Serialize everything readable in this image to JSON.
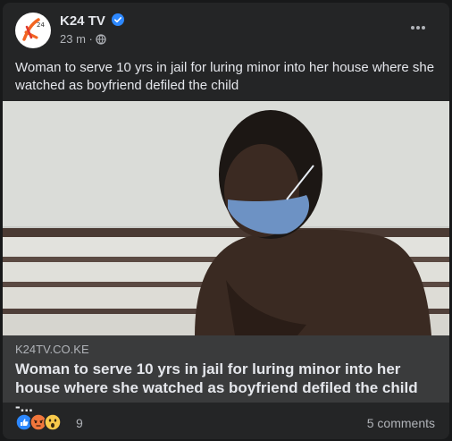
{
  "post": {
    "page_name": "K24 TV",
    "time": "23 m",
    "separator": "·",
    "avatar_icon": "k24-logo-icon",
    "verified_icon": "verified-badge-icon",
    "privacy_icon": "globe-icon",
    "more_icon": "more-options-icon",
    "text": "Woman to serve 10 yrs in jail for luring minor into her house where she watched as boyfriend defiled the child"
  },
  "link_preview": {
    "domain": "K24TV.CO.KE",
    "title": "Woman to serve 10 yrs in jail for luring minor into her house where she watched as boyfriend defiled the child -..."
  },
  "footer": {
    "reactions": [
      "like-reaction-icon",
      "angry-reaction-icon",
      "wow-reaction-icon"
    ],
    "reaction_count": "9",
    "comments": "5 comments"
  },
  "colors": {
    "card_bg": "#242526",
    "link_bg": "#3a3b3c",
    "primary_text": "#e4e6eb",
    "secondary_text": "#b0b3b8",
    "verified_blue": "#2d88ff",
    "logo_orange": "#f26522"
  }
}
